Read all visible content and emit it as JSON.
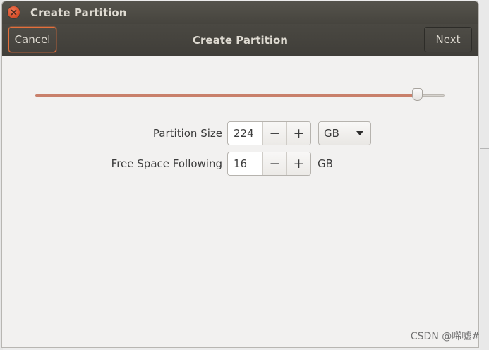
{
  "window": {
    "title": "Create Partition"
  },
  "headerbar": {
    "cancel_label": "Cancel",
    "title": "Create Partition",
    "next_label": "Next"
  },
  "size_slider": {
    "fraction": 0.934
  },
  "partition_size": {
    "label": "Partition Size",
    "value": "224",
    "minus": "−",
    "plus": "+",
    "unit": "GB"
  },
  "free_space": {
    "label": "Free Space Following",
    "value": "16",
    "minus": "−",
    "plus": "+",
    "unit": "GB"
  },
  "watermark": {
    "text": "CSDN @唏嘘#"
  },
  "colors": {
    "accent": "#c9806b",
    "focus_ring": "#e46f3b",
    "titlebar": "#4a4842",
    "close_button": "#d9512c"
  },
  "icons": {
    "close": "close-icon",
    "dropdown": "chevron-down-icon"
  }
}
